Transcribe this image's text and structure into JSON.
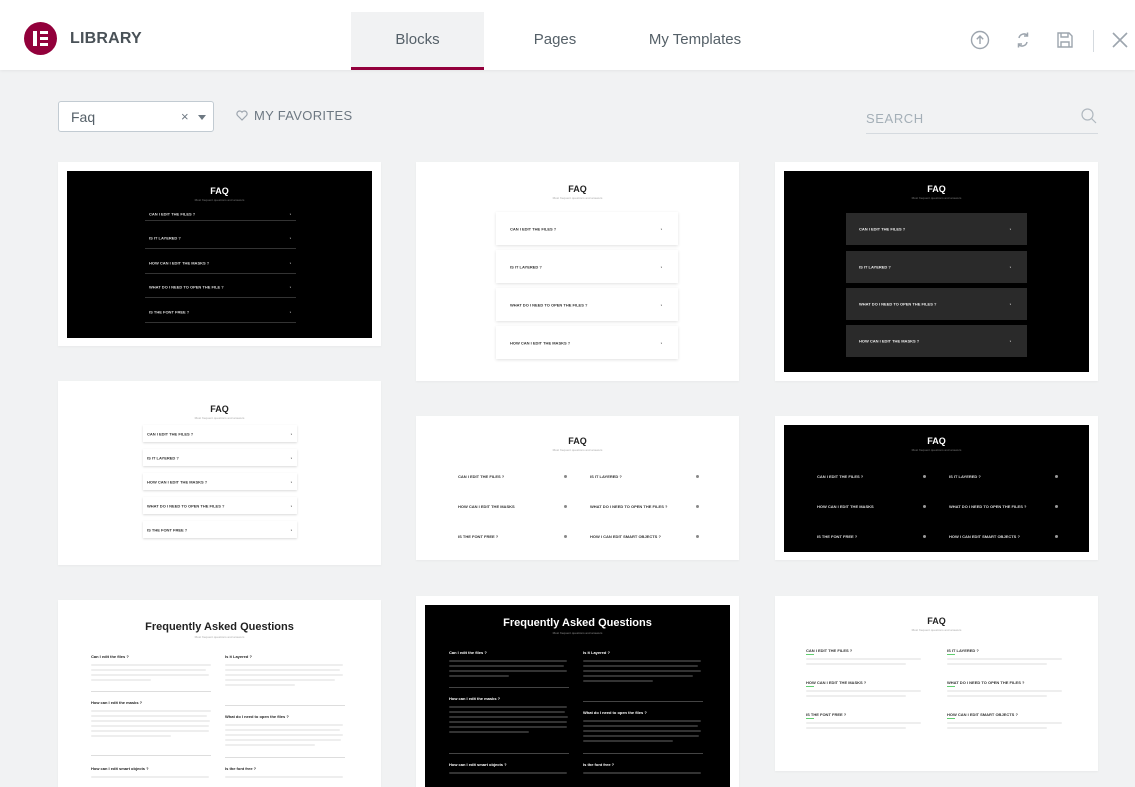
{
  "header": {
    "brand": "LIBRARY",
    "tabs": [
      {
        "label": "Blocks",
        "active": true
      },
      {
        "label": "Pages",
        "active": false
      },
      {
        "label": "My Templates",
        "active": false
      }
    ],
    "icons": [
      "upload-icon",
      "sync-icon",
      "save-icon",
      "close-icon"
    ]
  },
  "toolbar": {
    "category_value": "Faq",
    "clear_symbol": "×",
    "favorites_label": "MY FAVORITES",
    "search_placeholder": "SEARCH"
  },
  "colors": {
    "accent": "#93003c",
    "logo": "#92003b",
    "background": "#f1f2f3"
  },
  "templates": [
    {
      "title": "FAQ",
      "subtitle": "Most frequent questions and answers",
      "questions": [
        "CAN I EDIT THE FILES ?",
        "IS IT LAYERED ?",
        "HOW CAN I EDIT THE MASKS ?",
        "WHAT DO I NEED TO OPEN THE FILE ?",
        "IS THE FONT FREE ?"
      ],
      "arrow": "›"
    },
    {
      "title": "FAQ",
      "subtitle": "Most frequent questions and answers",
      "questions": [
        "CAN I EDIT THE FILES ?",
        "IS IT LAYERED ?",
        "WHAT DO I NEED TO OPEN THE FILES ?",
        "HOW CAN I EDIT THE MASKS ?"
      ],
      "arrow": "›"
    },
    {
      "title": "FAQ",
      "subtitle": "Most frequent questions and answers",
      "questions": [
        "CAN I EDIT THE FILES ?",
        "IS IT LAYERED ?",
        "WHAT DO I NEED TO OPEN THE FILES ?",
        "HOW CAN I EDIT THE MASKS ?"
      ],
      "arrow": "›"
    },
    {
      "title": "FAQ",
      "subtitle": "Most frequent questions and answers",
      "questions": [
        "CAN I EDIT THE FILES ?",
        "IS IT LAYERED ?",
        "HOW CAN I EDIT THE MASKS ?",
        "WHAT DO I NEED TO OPEN THE FILES ?",
        "IS THE FONT FREE ?"
      ],
      "arrow": "›"
    },
    {
      "title": "FAQ",
      "subtitle": "Most frequent questions and answers",
      "questions": [
        "CAN I EDIT THE FILES ?",
        "IS IT LAYERED ?",
        "HOW CAN I EDIT THE MASKS",
        "WHAT DO I NEED TO OPEN THE FILES ?",
        "IS THE FONT FREE ?",
        "HOW I CAN EDIT SMART OBJECTS ?"
      ]
    },
    {
      "title": "FAQ",
      "subtitle": "Most frequent questions and answers",
      "questions": [
        "CAN I EDIT THE FILES ?",
        "IS IT LAYERED ?",
        "HOW CAN I EDIT THE MASKS",
        "WHAT DO I NEED TO OPEN THE FILES ?",
        "IS THE FONT FREE ?",
        "HOW I CAN EDIT SMART OBJECTS ?"
      ]
    },
    {
      "title": "Frequently Asked Questions",
      "subtitle": "Most frequent questions and answers",
      "questions": [
        "Can I edit the files ?",
        "Is it Layered ?",
        "How can I edit the masks ?",
        "What do I need to open the files ?",
        "How can I edit smart objects ?",
        "Is the font free ?"
      ]
    },
    {
      "title": "Frequently Asked Questions",
      "subtitle": "Most frequent questions and answers",
      "questions": [
        "Can I edit the files ?",
        "Is it Layered ?",
        "How can I edit the masks ?",
        "What do I need to open the files ?",
        "How can I edit smart objects ?",
        "Is the font free ?"
      ]
    },
    {
      "title": "FAQ",
      "subtitle": "Most frequent questions and answers",
      "questions": [
        "CAN I EDIT THE FILES ?",
        "IS IT LAYERED ?",
        "HOW CAN I EDIT THE MASKS ?",
        "WHAT DO I NEED TO OPEN THE FILES ?",
        "IS THE FONT FREE ?",
        "HOW CAN I EDIT SMART OBJECTS ?"
      ]
    }
  ]
}
